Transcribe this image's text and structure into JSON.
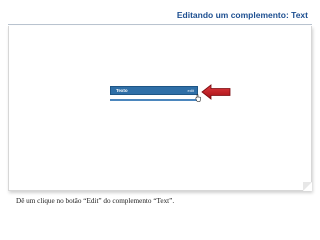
{
  "header": {
    "title": "Editando um complemento: Text"
  },
  "widget": {
    "title": "Texto",
    "edit_label": "edit",
    "bar_color": "#2f6fa7"
  },
  "pointer": {
    "color": "#c4161c",
    "icon": "arrow-left-icon"
  },
  "caption": {
    "text": "Dê um clique no botão “Edit” do complemento “Text”."
  },
  "colors": {
    "title": "#1d4f91",
    "accent": "#2f6fa7"
  }
}
